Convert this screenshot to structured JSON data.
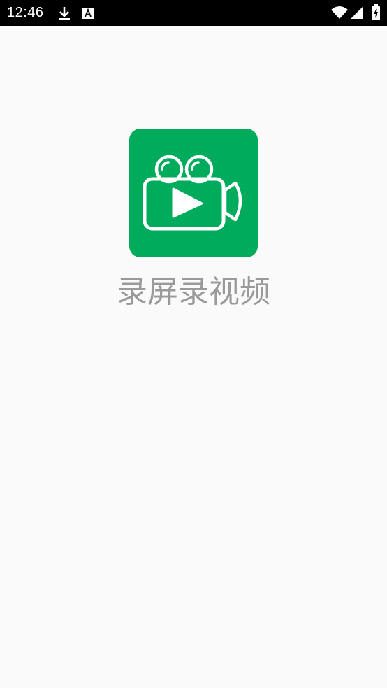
{
  "status_bar": {
    "time": "12:46",
    "icons": [
      "download-icon",
      "text-a-icon",
      "wifi-icon",
      "signal-icon",
      "battery-icon"
    ]
  },
  "splash": {
    "app_name": "录屏录视频",
    "icon": "video-camera-icon",
    "brand_color": "#00ab5b"
  }
}
